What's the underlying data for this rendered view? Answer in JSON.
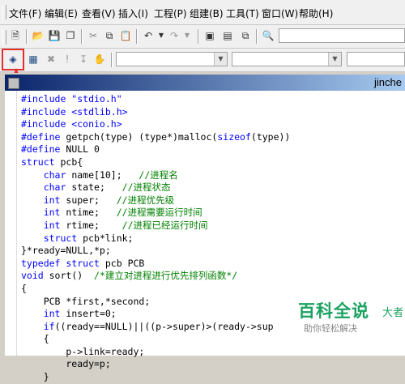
{
  "menu": {
    "items": [
      "文件(F)",
      "编辑(E)",
      "查看(V)",
      "插入(I)",
      "工程(P)",
      "组建(B)",
      "工具(T)",
      "窗口(W)",
      "帮助(H)"
    ]
  },
  "toolbar": {
    "icons": [
      "new-file-icon",
      "open-folder-icon",
      "save-icon",
      "save-all-icon",
      "cut-icon",
      "copy-icon",
      "paste-icon",
      "undo-icon",
      "redo-icon",
      "workspace-icon",
      "output-icon",
      "windows-list-icon",
      "find-in-files-icon"
    ],
    "build_icons": [
      "compile-icon",
      "build-icon",
      "stop-build-icon",
      "execute-icon",
      "go-icon",
      "insert-breakpoint-icon"
    ]
  },
  "editor": {
    "title": "jinche"
  },
  "code_lines": [
    [
      {
        "t": "#include \"stdio.h\"",
        "c": "kw"
      }
    ],
    [
      {
        "t": "#include <stdlib.h>",
        "c": "kw"
      }
    ],
    [
      {
        "t": "#include <conio.h>",
        "c": "kw"
      }
    ],
    [
      {
        "t": "#define",
        "c": "kw"
      },
      {
        "t": " getpch(type) (type*)malloc(",
        "c": ""
      },
      {
        "t": "sizeof",
        "c": "kw"
      },
      {
        "t": "(type))",
        "c": ""
      }
    ],
    [
      {
        "t": "#define",
        "c": "kw"
      },
      {
        "t": " NULL 0",
        "c": ""
      }
    ],
    [
      {
        "t": "struct",
        "c": "kw"
      },
      {
        "t": " pcb{",
        "c": ""
      }
    ],
    [
      {
        "t": "    ",
        "c": ""
      },
      {
        "t": "char",
        "c": "kw"
      },
      {
        "t": " name[10];   ",
        "c": ""
      },
      {
        "t": "//进程名",
        "c": "cm"
      }
    ],
    [
      {
        "t": "    ",
        "c": ""
      },
      {
        "t": "char",
        "c": "kw"
      },
      {
        "t": " state;   ",
        "c": ""
      },
      {
        "t": "//进程状态",
        "c": "cm"
      }
    ],
    [
      {
        "t": "    ",
        "c": ""
      },
      {
        "t": "int",
        "c": "kw"
      },
      {
        "t": " super;   ",
        "c": ""
      },
      {
        "t": "//进程优先级",
        "c": "cm"
      }
    ],
    [
      {
        "t": "    ",
        "c": ""
      },
      {
        "t": "int",
        "c": "kw"
      },
      {
        "t": " ntime;   ",
        "c": ""
      },
      {
        "t": "//进程需要运行时间",
        "c": "cm"
      }
    ],
    [
      {
        "t": "    ",
        "c": ""
      },
      {
        "t": "int",
        "c": "kw"
      },
      {
        "t": " rtime;    ",
        "c": ""
      },
      {
        "t": "//进程已经运行时间",
        "c": "cm"
      }
    ],
    [
      {
        "t": "    ",
        "c": ""
      },
      {
        "t": "struct",
        "c": "kw"
      },
      {
        "t": " pcb*link;",
        "c": ""
      }
    ],
    [
      {
        "t": "}*ready=NULL,*p;",
        "c": ""
      }
    ],
    [
      {
        "t": "typedef",
        "c": "kw"
      },
      {
        "t": " ",
        "c": ""
      },
      {
        "t": "struct",
        "c": "kw"
      },
      {
        "t": " pcb PCB",
        "c": ""
      }
    ],
    [
      {
        "t": "void",
        "c": "kw"
      },
      {
        "t": " sort()  ",
        "c": ""
      },
      {
        "t": "/*建立对进程进行优先排列函数*/",
        "c": "cm"
      }
    ],
    [
      {
        "t": "{",
        "c": ""
      }
    ],
    [
      {
        "t": "    PCB *first,*second;",
        "c": ""
      }
    ],
    [
      {
        "t": "    ",
        "c": ""
      },
      {
        "t": "int",
        "c": "kw"
      },
      {
        "t": " insert=0;",
        "c": ""
      }
    ],
    [
      {
        "t": "    ",
        "c": ""
      },
      {
        "t": "if",
        "c": "kw"
      },
      {
        "t": "((ready==NULL)||((p->super)>(ready->sup",
        "c": ""
      }
    ],
    [
      {
        "t": "    {",
        "c": ""
      }
    ],
    [
      {
        "t": "        p->link=ready;",
        "c": ""
      }
    ],
    [
      {
        "t": "        ready=p;",
        "c": ""
      }
    ],
    [
      {
        "t": "    }",
        "c": ""
      }
    ]
  ],
  "watermark": {
    "title": "百科全说",
    "subtitle": "助你轻松解决",
    "extra": "大者"
  },
  "colors": {
    "keyword": "#0000ff",
    "comment": "#008000",
    "highlight": "#e03030",
    "watermark": "#1aa260"
  }
}
